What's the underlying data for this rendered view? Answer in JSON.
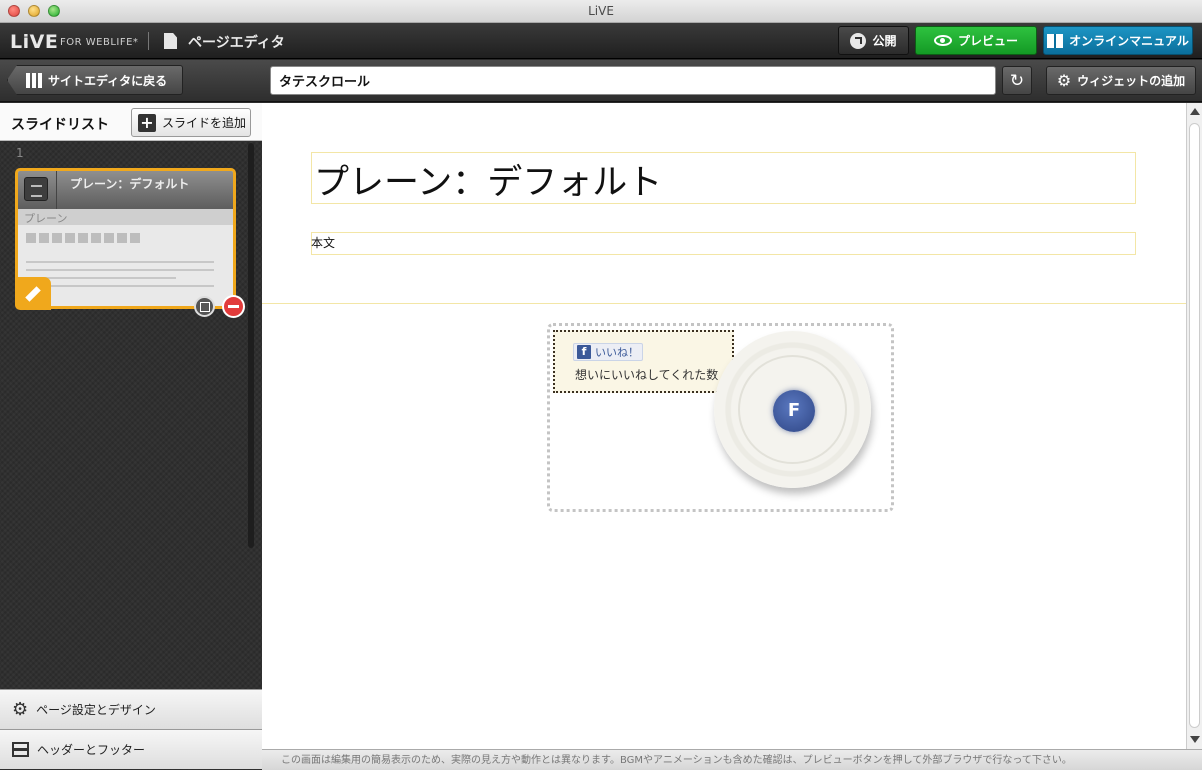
{
  "window": {
    "title": "LiVE"
  },
  "app": {
    "logo": "LiVE",
    "logo_sub": "FOR WEBLIFE*",
    "editor_title": "ページエディタ",
    "publish_label": "公開",
    "preview_label": "プレビュー",
    "manual_label": "オンラインマニュアル"
  },
  "toolbar": {
    "back_label": "サイトエディタに戻る",
    "page_title_value": "タテスクロール",
    "add_widget_label": "ウィジェットの追加"
  },
  "sidebar": {
    "title": "スライドリスト",
    "add_slide_label": "スライドを追加",
    "slides": [
      {
        "number": "1",
        "name": "プレーン：デフォルト",
        "type": "プレーン"
      }
    ],
    "page_settings_label": "ページ設定とデザイン",
    "header_footer_label": "ヘッダーとフッター"
  },
  "canvas": {
    "heading": "プレーン：デフォルト",
    "body": "本文",
    "like_label": "いいね！",
    "like_caption": "想いにいいねしてくれた数",
    "badge_letter": "F"
  },
  "notice": "この画面は編集用の簡易表示のため、実際の見え方や動作とは異なります。BGMやアニメーションも含めた確認は、プレビューボタンを押して外部ブラウザで行なって下さい。",
  "colors": {
    "preview": "#149a25",
    "manual": "#0b6f9c",
    "slide_highlight": "#f0a81c",
    "delete": "#e23b3b",
    "facebook": "#3b5998"
  },
  "icons": [
    "publish-icon",
    "eye-icon",
    "book-icon",
    "grid-icon",
    "reload-icon",
    "gear-icon",
    "plus-icon",
    "list-icon",
    "pencil-icon",
    "duplicate-icon",
    "minus-icon",
    "facebook-icon",
    "header-footer-icon"
  ]
}
